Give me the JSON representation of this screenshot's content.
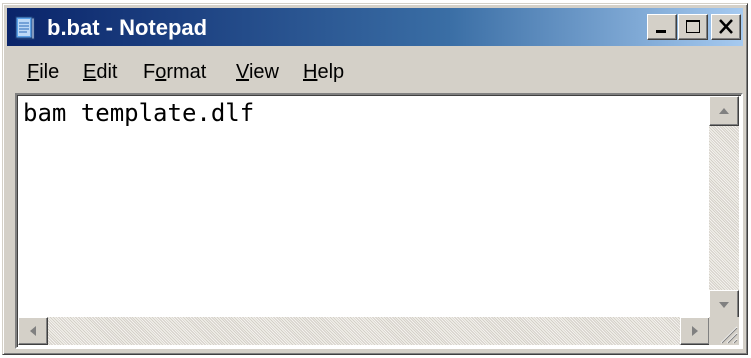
{
  "window": {
    "title": "b.bat - Notepad",
    "title_gradient_start": "#0a246a",
    "title_gradient_end": "#a6caf0",
    "icon": "notepad-icon"
  },
  "title_buttons": {
    "minimize_icon": "minimize-icon",
    "maximize_icon": "maximize-icon",
    "close_icon": "close-icon"
  },
  "menu": {
    "items": [
      {
        "accel": "F",
        "rest": "ile"
      },
      {
        "accel": "E",
        "rest": "dit"
      },
      {
        "pre": "F",
        "accel": "o",
        "rest": "rmat"
      },
      {
        "accel": "V",
        "rest": "iew"
      },
      {
        "accel": "H",
        "rest": "elp"
      }
    ]
  },
  "editor": {
    "content": "bam template.dlf"
  },
  "scrollbars": {
    "up_icon": "arrow-up-icon",
    "down_icon": "arrow-down-icon",
    "left_icon": "arrow-left-icon",
    "right_icon": "arrow-right-icon",
    "grip_icon": "resize-grip-icon"
  }
}
